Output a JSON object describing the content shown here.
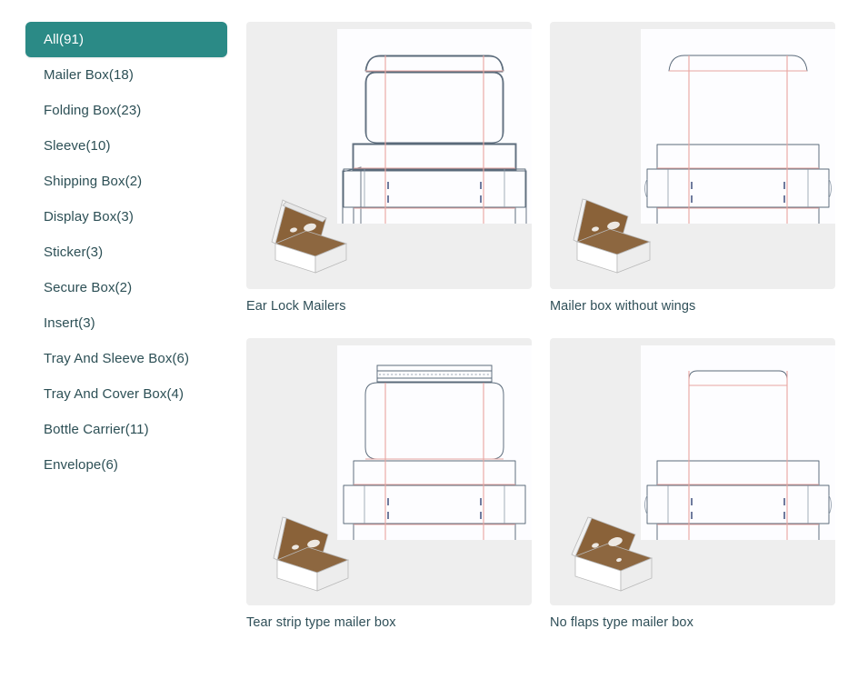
{
  "sidebar": {
    "name": "category-filter",
    "items": [
      {
        "label": "All(91)",
        "active": true
      },
      {
        "label": "Mailer Box(18)",
        "active": false
      },
      {
        "label": "Folding Box(23)",
        "active": false
      },
      {
        "label": "Sleeve(10)",
        "active": false
      },
      {
        "label": "Shipping Box(2)",
        "active": false
      },
      {
        "label": "Display Box(3)",
        "active": false
      },
      {
        "label": "Sticker(3)",
        "active": false
      },
      {
        "label": "Secure Box(2)",
        "active": false
      },
      {
        "label": "Insert(3)",
        "active": false
      },
      {
        "label": "Tray And Sleeve Box(6)",
        "active": false
      },
      {
        "label": "Tray And Cover Box(4)",
        "active": false
      },
      {
        "label": "Bottle Carrier(11)",
        "active": false
      },
      {
        "label": "Envelope(6)",
        "active": false
      }
    ]
  },
  "gallery": {
    "cards": [
      {
        "label": "Ear Lock Mailers",
        "dieline": "ear-lock-mailer-dieline",
        "preview": "mailer-box-3d-preview"
      },
      {
        "label": "Mailer box without wings",
        "dieline": "mailer-no-wings-dieline",
        "preview": "mailer-box-3d-preview"
      },
      {
        "label": "Tear strip type mailer box",
        "dieline": "tear-strip-mailer-dieline",
        "preview": "mailer-box-3d-preview"
      },
      {
        "label": "No flaps type mailer box",
        "dieline": "no-flaps-mailer-dieline",
        "preview": "mailer-box-3d-preview"
      }
    ]
  },
  "colors": {
    "accent": "#2b8a86",
    "text": "#2f4f58",
    "card_background": "#eeeeee",
    "stage_background": "#fdfdff",
    "page_background": "#ffffff",
    "dieline_cut": "#5a6a7a",
    "dieline_crease": "#e8a5a0",
    "box_kraft": "#8a6239",
    "box_white": "#f4f4f4"
  }
}
